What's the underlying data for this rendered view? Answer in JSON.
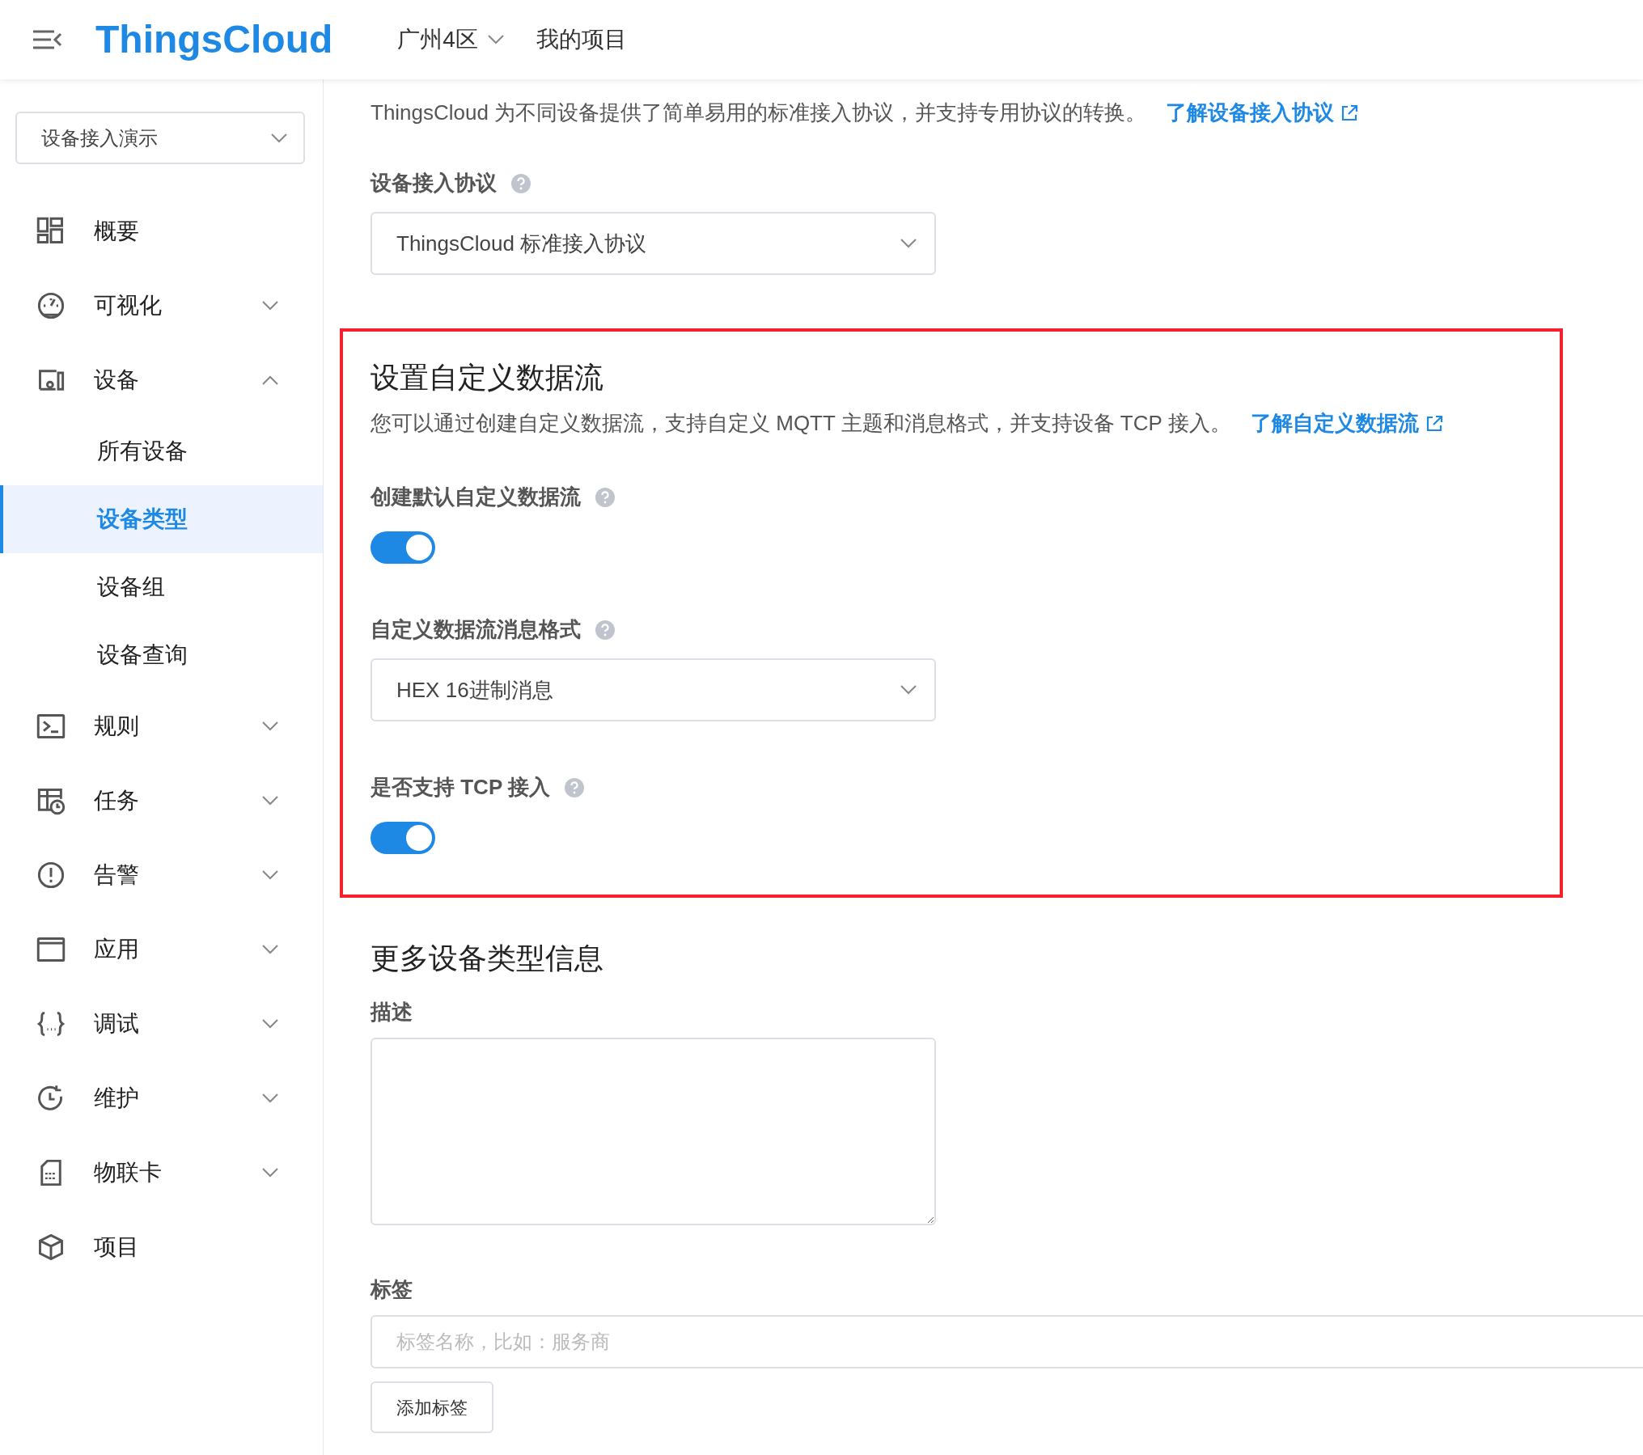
{
  "header": {
    "logo": "ThingsCloud",
    "region": "广州4区",
    "project_link": "我的项目"
  },
  "sidebar": {
    "project_select": {
      "value": "设备接入演示"
    },
    "items": [
      {
        "label": "概要",
        "selected": false
      },
      {
        "label": "可视化",
        "expanded": false,
        "selected": false
      },
      {
        "label": "设备",
        "expanded": true,
        "selected": false,
        "children": [
          {
            "label": "所有设备",
            "selected": false
          },
          {
            "label": "设备类型",
            "selected": true
          },
          {
            "label": "设备组",
            "selected": false
          },
          {
            "label": "设备查询",
            "selected": false
          }
        ]
      },
      {
        "label": "规则",
        "expanded": false,
        "selected": false
      },
      {
        "label": "任务",
        "expanded": false,
        "selected": false
      },
      {
        "label": "告警",
        "expanded": false,
        "selected": false
      },
      {
        "label": "应用",
        "expanded": false,
        "selected": false
      },
      {
        "label": "调试",
        "expanded": false,
        "selected": false
      },
      {
        "label": "维护",
        "expanded": false,
        "selected": false
      },
      {
        "label": "物联卡",
        "expanded": false,
        "selected": false
      },
      {
        "label": "项目",
        "selected": false
      }
    ]
  },
  "access_section": {
    "description": "ThingsCloud 为不同设备提供了简单易用的标准接入协议，并支持专用协议的转换。",
    "link": "了解设备接入协议",
    "fields": [
      {
        "kind": "select",
        "label": "设备接入协议",
        "value": "ThingsCloud 标准接入协议"
      }
    ]
  },
  "custom_stream_section": {
    "title": "设置自定义数据流",
    "description": "您可以通过创建自定义数据流，支持自定义 MQTT 主题和消息格式，并支持设备 TCP 接入。",
    "link": "了解自定义数据流",
    "fields": [
      {
        "kind": "switch",
        "label": "创建默认自定义数据流",
        "on": true
      },
      {
        "kind": "select",
        "label": "自定义数据流消息格式",
        "value": "HEX 16进制消息"
      },
      {
        "kind": "switch",
        "label": "是否支持 TCP 接入",
        "on": true
      }
    ]
  },
  "more_section": {
    "title": "更多设备类型信息",
    "description_label": "描述",
    "tags_label": "标签",
    "tags_placeholder": "标签名称，比如：服务商",
    "add_tag_button": "添加标签"
  }
}
